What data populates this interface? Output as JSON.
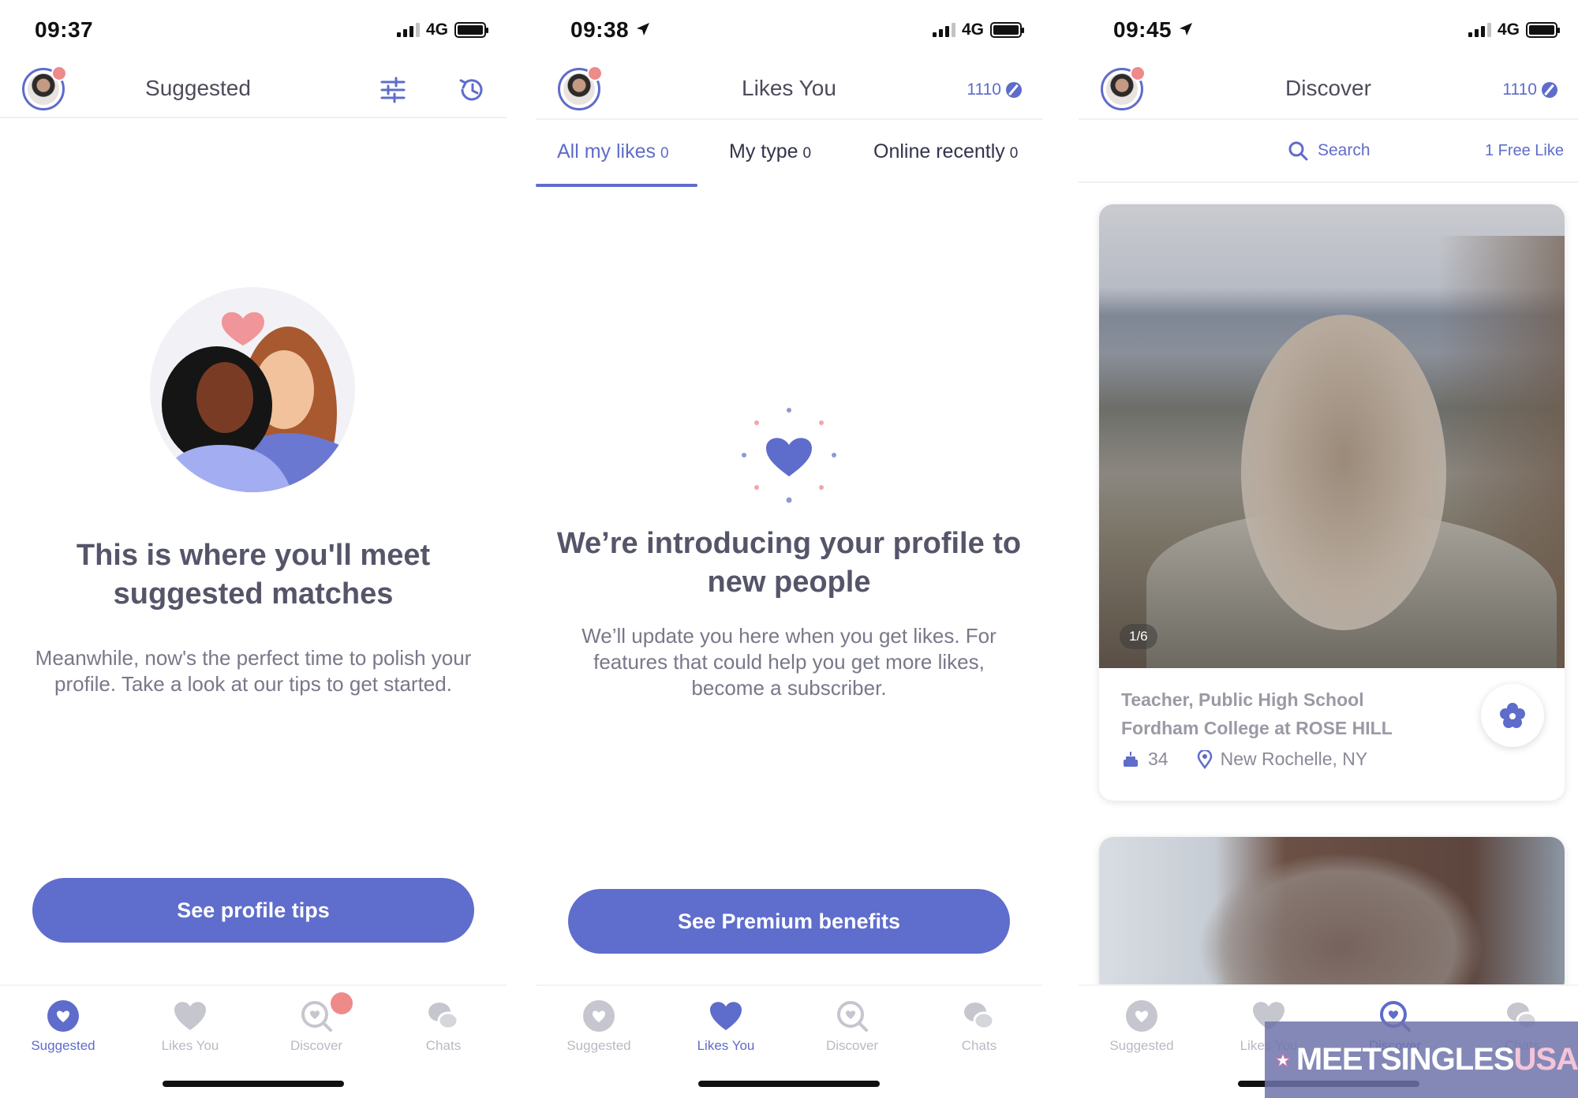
{
  "phones": [
    {
      "status": {
        "time": "09:37",
        "network": "4G"
      },
      "header": {
        "title": "Suggested"
      },
      "heading": "This is where you'll meet suggested matches",
      "body": "Meanwhile, now's the perfect time to polish your profile. Take a look at our tips to get started.",
      "cta": "See profile tips"
    },
    {
      "status": {
        "time": "09:38",
        "network": "4G"
      },
      "header": {
        "title": "Likes You",
        "count": "1110"
      },
      "tabs": [
        {
          "label": "All my likes",
          "count": "0"
        },
        {
          "label": "My type",
          "count": "0"
        },
        {
          "label": "Online recently",
          "count": "0"
        }
      ],
      "heading": "We’re introducing your profile to new people",
      "body": "We’ll update you here when you get likes. For features that could help you get more likes, become a subscriber.",
      "cta": "See Premium benefits"
    },
    {
      "status": {
        "time": "09:45",
        "network": "4G"
      },
      "header": {
        "title": "Discover",
        "count": "1110"
      },
      "search": {
        "label": "Search",
        "free_like": "1 Free Like"
      },
      "card": {
        "photo_counter": "1/6",
        "job": "Teacher, Public High School",
        "school": "Fordham College at ROSE HILL",
        "age": "34",
        "location": "New Rochelle, NY"
      }
    }
  ],
  "tabbar": {
    "suggested": "Suggested",
    "likes_you": "Likes You",
    "discover": "Discover",
    "chats": "Chats"
  },
  "watermark": {
    "text_main": "MEETSINGLES",
    "text_accent": "USA"
  },
  "colors": {
    "accent": "#5e6ccb",
    "notification": "#ef8a8a",
    "inactive": "#b9b9c4"
  }
}
